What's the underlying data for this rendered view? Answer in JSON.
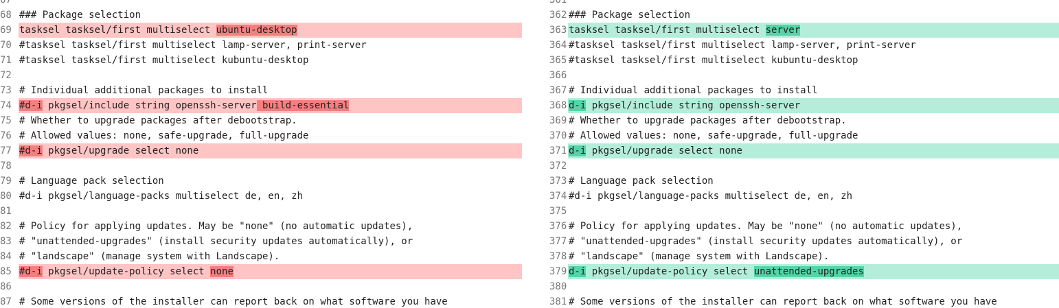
{
  "left": {
    "lines": [
      {
        "n": "67",
        "text": "",
        "type": "ctx"
      },
      {
        "n": "68",
        "text": "### Package selection",
        "type": "ctx"
      },
      {
        "n": "69",
        "type": "del",
        "pre": "tasksel tasksel/first multiselect ",
        "hl": "ubuntu-desktop",
        "post": ""
      },
      {
        "n": "70",
        "text": "#tasksel tasksel/first multiselect lamp-server, print-server",
        "type": "ctx"
      },
      {
        "n": "71",
        "text": "#tasksel tasksel/first multiselect kubuntu-desktop",
        "type": "ctx"
      },
      {
        "n": "72",
        "text": "",
        "type": "ctx"
      },
      {
        "n": "73",
        "text": "# Individual additional packages to install",
        "type": "ctx"
      },
      {
        "n": "74",
        "type": "del",
        "pre": "",
        "hl": "#d-i",
        "post": " pkgsel/include string openssh-server",
        "hl2": " build-essential"
      },
      {
        "n": "75",
        "text": "# Whether to upgrade packages after debootstrap.",
        "type": "ctx"
      },
      {
        "n": "76",
        "text": "# Allowed values: none, safe-upgrade, full-upgrade",
        "type": "ctx"
      },
      {
        "n": "77",
        "type": "del",
        "pre": "",
        "hl": "#d-i",
        "post": " pkgsel/upgrade select none"
      },
      {
        "n": "78",
        "text": "",
        "type": "ctx"
      },
      {
        "n": "79",
        "text": "# Language pack selection",
        "type": "ctx"
      },
      {
        "n": "80",
        "text": "#d-i pkgsel/language-packs multiselect de, en, zh",
        "type": "ctx"
      },
      {
        "n": "81",
        "text": "",
        "type": "ctx"
      },
      {
        "n": "82",
        "text": "# Policy for applying updates. May be \"none\" (no automatic updates),",
        "type": "ctx"
      },
      {
        "n": "83",
        "text": "# \"unattended-upgrades\" (install security updates automatically), or",
        "type": "ctx"
      },
      {
        "n": "84",
        "text": "# \"landscape\" (manage system with Landscape).",
        "type": "ctx"
      },
      {
        "n": "85",
        "type": "del",
        "pre": "",
        "hl": "#d-i",
        "post": " pkgsel/update-policy select ",
        "hl2": "none"
      },
      {
        "n": "86",
        "text": "",
        "type": "ctx"
      },
      {
        "n": "87",
        "text": "# Some versions of the installer can report back on what software you have",
        "type": "ctx"
      }
    ]
  },
  "right": {
    "lines": [
      {
        "n": "361",
        "text": "",
        "type": "ctx"
      },
      {
        "n": "362",
        "text": "### Package selection",
        "type": "ctx"
      },
      {
        "n": "363",
        "type": "ins",
        "pre": "tasksel tasksel/first multiselect ",
        "hl": "server",
        "post": ""
      },
      {
        "n": "364",
        "text": "#tasksel tasksel/first multiselect lamp-server, print-server",
        "type": "ctx"
      },
      {
        "n": "365",
        "text": "#tasksel tasksel/first multiselect kubuntu-desktop",
        "type": "ctx"
      },
      {
        "n": "366",
        "text": "",
        "type": "ctx"
      },
      {
        "n": "367",
        "text": "# Individual additional packages to install",
        "type": "ctx"
      },
      {
        "n": "368",
        "type": "ins",
        "pre": "",
        "hl": "d-i",
        "post": " pkgsel/include string openssh-server"
      },
      {
        "n": "369",
        "text": "# Whether to upgrade packages after debootstrap.",
        "type": "ctx"
      },
      {
        "n": "370",
        "text": "# Allowed values: none, safe-upgrade, full-upgrade",
        "type": "ctx"
      },
      {
        "n": "371",
        "type": "ins",
        "pre": "",
        "hl": "d-i",
        "post": " pkgsel/upgrade select none"
      },
      {
        "n": "372",
        "text": "",
        "type": "ctx"
      },
      {
        "n": "373",
        "text": "# Language pack selection",
        "type": "ctx"
      },
      {
        "n": "374",
        "text": "#d-i pkgsel/language-packs multiselect de, en, zh",
        "type": "ctx"
      },
      {
        "n": "375",
        "text": "",
        "type": "ctx"
      },
      {
        "n": "376",
        "text": "# Policy for applying updates. May be \"none\" (no automatic updates),",
        "type": "ctx"
      },
      {
        "n": "377",
        "text": "# \"unattended-upgrades\" (install security updates automatically), or",
        "type": "ctx"
      },
      {
        "n": "378",
        "text": "# \"landscape\" (manage system with Landscape).",
        "type": "ctx"
      },
      {
        "n": "379",
        "type": "ins",
        "pre": "",
        "hl": "d-i",
        "post": " pkgsel/update-policy select ",
        "hl2": "unattended-upgrades"
      },
      {
        "n": "380",
        "text": "",
        "type": "ctx"
      },
      {
        "n": "381",
        "text": "# Some versions of the installer can report back on what software you have",
        "type": "ctx"
      }
    ]
  }
}
